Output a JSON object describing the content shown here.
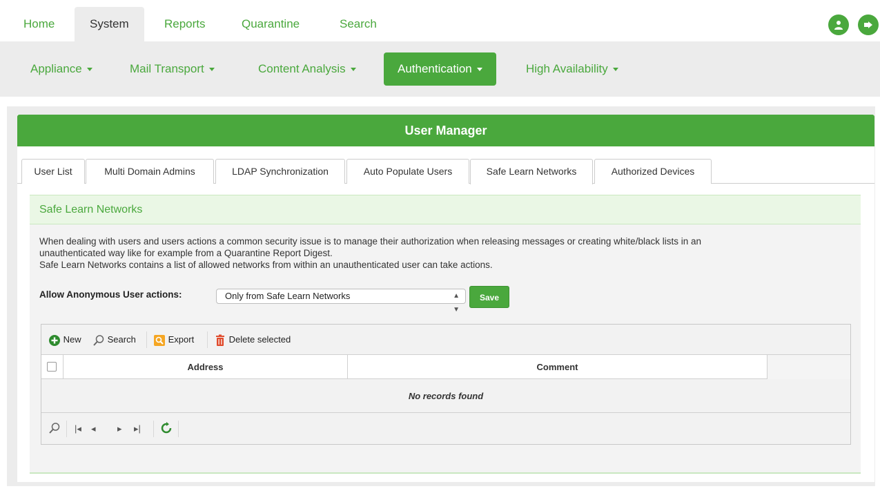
{
  "top_nav": {
    "tabs": [
      "Home",
      "System",
      "Reports",
      "Quarantine",
      "Search"
    ],
    "active": "System"
  },
  "sub_nav": {
    "items": [
      "Appliance",
      "Mail Transport",
      "Content Analysis",
      "Authentication",
      "High Availability"
    ],
    "active": "Authentication"
  },
  "panel": {
    "title": "User Manager",
    "tabs": [
      "User List",
      "Multi Domain Admins",
      "LDAP Synchronization",
      "Auto Populate Users",
      "Safe Learn Networks",
      "Authorized Devices"
    ],
    "active_tab": "Safe Learn Networks"
  },
  "section": {
    "title": "Safe Learn Networks",
    "desc_line1": "When dealing with users and users actions a common security issue is to manage their authorization when releasing messages or creating white/black lists in an",
    "desc_line2": "unauthenticated way like for example from a Quarantine Report Digest.",
    "desc_line3": "Safe Learn Networks contains a list of allowed networks from within an unauthenticated user can take actions.",
    "anon_label": "Allow Anonymous User actions:",
    "anon_value": "Only from Safe Learn Networks",
    "save_label": "Save"
  },
  "grid": {
    "toolbar": {
      "new": "New",
      "search": "Search",
      "export": "Export",
      "delete": "Delete selected"
    },
    "columns": [
      "Address",
      "Comment"
    ],
    "empty": "No records found"
  },
  "colors": {
    "accent": "#4aa83d",
    "tab_bg": "#ececec"
  }
}
